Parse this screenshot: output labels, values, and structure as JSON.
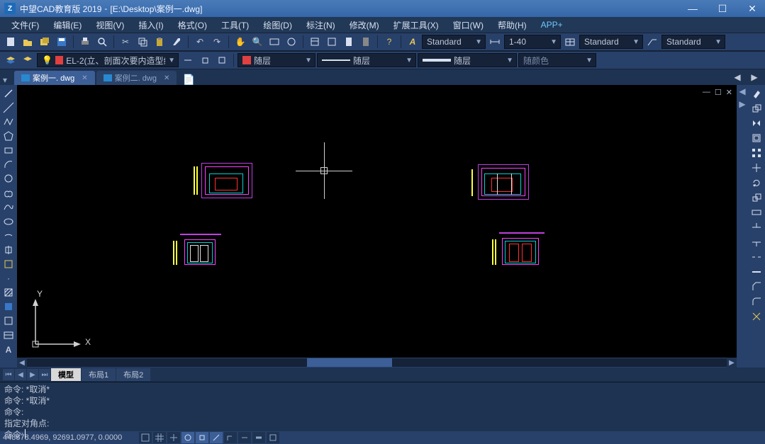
{
  "title": {
    "app": "中望CAD教育版  2019",
    "file": "[E:\\Desktop\\案例一.dwg]"
  },
  "menu": {
    "items": [
      "文件(F)",
      "编辑(E)",
      "视图(V)",
      "插入(I)",
      "格式(O)",
      "工具(T)",
      "绘图(D)",
      "标注(N)",
      "修改(M)",
      "扩展工具(X)",
      "窗口(W)",
      "帮助(H)",
      "APP+"
    ]
  },
  "toolbar2": {
    "layer": "EL-2(立、剖面次要内造型线",
    "by1": "随层",
    "by2": "随层",
    "by3": "随层",
    "bycolor": "随颜色",
    "style1": "Standard",
    "dimscale": "1-40",
    "style2": "Standard",
    "style3": "Standard"
  },
  "doctabs": [
    {
      "label": "案例一. dwg",
      "active": true
    },
    {
      "label": "案例二. dwg",
      "active": false
    }
  ],
  "layouttabs": {
    "model": "模型",
    "l1": "布局1",
    "l2": "布局2"
  },
  "cmd": {
    "lines": [
      "命令: *取消*",
      "命令: *取消*",
      "命令:",
      "指定对角点:"
    ],
    "prompt": "命令:"
  },
  "status": {
    "coords": "448878.4969, 92691.0977, 0.0000"
  },
  "axis": {
    "x": "X",
    "y": "Y"
  }
}
